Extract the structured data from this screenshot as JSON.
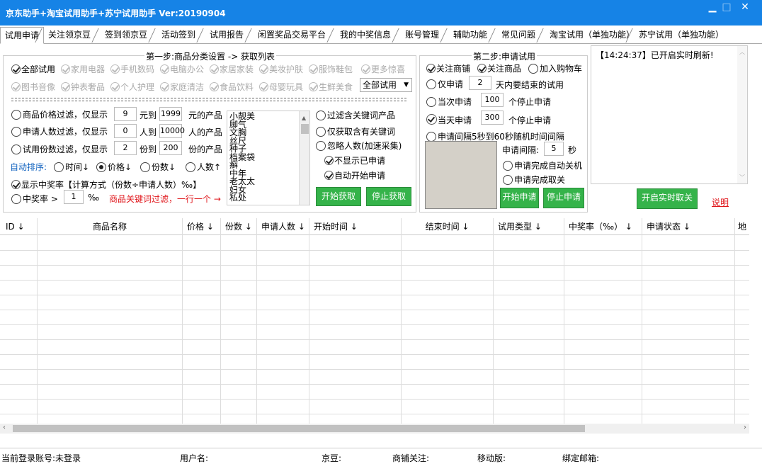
{
  "window": {
    "title": "京东助手+淘宝试用助手+苏宁试用助手 Ver:20190904",
    "minimize": "▁",
    "maximize": "□",
    "close": "✕"
  },
  "tabs": [
    "试用申请",
    "关注领京豆",
    "签到领京豆",
    "活动签到",
    "试用报告",
    "闲置奖品交易平台",
    "我的中奖信息",
    "账号管理",
    "辅助功能",
    "常见问题",
    "淘宝试用（单独功能）",
    "苏宁试用（单独功能）"
  ],
  "step1": {
    "title": "第一步:商品分类设置 -> 获取列表",
    "categories_row1": [
      "全部试用",
      "家用电器",
      "手机数码",
      "电脑办公",
      "家居家装",
      "美妆护肤",
      "服饰鞋包",
      "更多惊喜"
    ],
    "categories_row2": [
      "图书音像",
      "钟表奢品",
      "个人护理",
      "家庭清洁",
      "食品饮料",
      "母婴玩具",
      "生鲜美食"
    ],
    "category_select": "全部试用",
    "price_filter": {
      "label": "商品价格过滤，仅显示",
      "min": "9",
      "mid": "元到",
      "max": "1999",
      "suffix": "元的产品"
    },
    "applicants_filter": {
      "label": "申请人数过滤，仅显示",
      "min": "0",
      "mid": "人到",
      "max": "10000",
      "suffix": "人的产品"
    },
    "copies_filter": {
      "label": "试用份数过滤，仅显示",
      "min": "2",
      "mid": "份到",
      "max": "200",
      "suffix": "份的产品"
    },
    "sort_label": "自动排序:",
    "sort_options": [
      "时间↓",
      "价格↓",
      "份数↓",
      "人数↑"
    ],
    "show_rate": "显示中奖率【计算方式（份数÷申请人数）‰】",
    "rate_label": "中奖率 >",
    "rate_value": "1",
    "rate_unit": "‰",
    "keyword_hint": "商品关键词过滤，一行一个 →",
    "keywords": [
      "小靓美",
      "脚气",
      "文胸",
      "丝尺",
      "种子",
      "档案袋",
      "癣",
      "中年",
      "老太太",
      "妇女",
      "私处"
    ],
    "options": [
      "过滤含关键词产品",
      "仅获取含有关键词",
      "忽略人数(加速采集)",
      "不显示已申请",
      "自动开始申请"
    ],
    "start_btn": "开始获取",
    "stop_btn": "停止获取"
  },
  "step2": {
    "title": "第二步:申请试用",
    "follow_shop": "关注商铺",
    "follow_product": "关注商品",
    "add_cart": "加入购物车",
    "only_apply": "仅申请",
    "only_days": "2",
    "only_suffix": "天内要结束的试用",
    "times_label": "当次申请",
    "times_value": "100",
    "times_suffix": "个停止申请",
    "day_label": "当天申请",
    "day_value": "300",
    "day_suffix": "个停止申请",
    "random_interval": "申请间隔5秒到60秒随机时间间隔",
    "interval_label": "申请间隔:",
    "interval_value": "5",
    "interval_unit": "秒",
    "auto_shutdown": "申请完成自动关机",
    "auto_unfollow": "申请完成取关",
    "start_btn": "开始申请",
    "stop_btn": "停止申请"
  },
  "log": {
    "text": "【14:24:37】已开启实时刷新!",
    "realtime_btn": "开启实时取关",
    "help_link": "说明"
  },
  "grid": {
    "headers": [
      "ID ↓",
      "商品名称",
      "价格 ↓",
      "份数 ↓",
      "申请人数 ↓",
      "开始时间 ↓",
      "结束时间 ↓",
      "试用类型 ↓",
      "中奖率（‰） ↓",
      "申请状态 ↓",
      "地"
    ]
  },
  "status": {
    "account": "当前登录账号:未登录",
    "username": "用户名:",
    "jingdou": "京豆:",
    "shop_follow": "商铺关注:",
    "mobile": "移动版:",
    "email": "绑定邮箱:"
  },
  "colors": {
    "titlebar": "#1683e6",
    "button": "#35b34a",
    "hint": "#e0161b"
  }
}
